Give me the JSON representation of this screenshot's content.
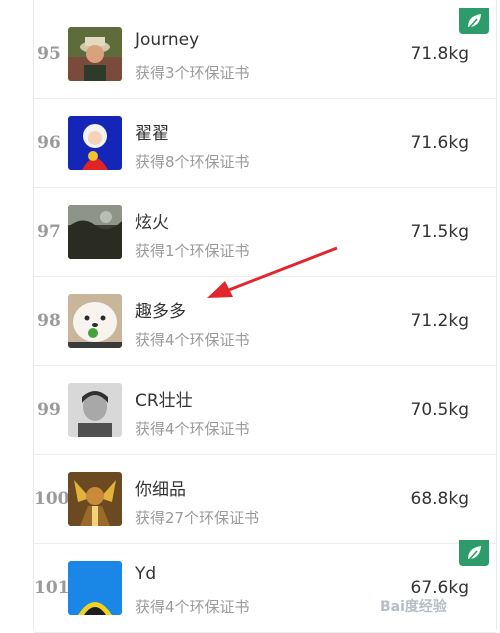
{
  "list": {
    "rows": [
      {
        "rank": "95",
        "name": "Journey",
        "certs": "获得3个环保证书",
        "weight": "71.8kg",
        "badge": true,
        "avatar": "avatar-man-outdoor-icon"
      },
      {
        "rank": "96",
        "name": "翟翟",
        "certs": "获得8个环保证书",
        "weight": "71.6kg",
        "badge": false,
        "avatar": "avatar-cartoon-girl-icon"
      },
      {
        "rank": "97",
        "name": "炫火",
        "certs": "获得1个环保证书",
        "weight": "71.5kg",
        "badge": false,
        "avatar": "avatar-dark-landscape-icon"
      },
      {
        "rank": "98",
        "name": "趣多多",
        "certs": "获得4个环保证书",
        "weight": "71.2kg",
        "badge": false,
        "avatar": "avatar-white-dog-icon"
      },
      {
        "rank": "99",
        "name": "CR壮壮",
        "certs": "获得4个环保证书",
        "weight": "70.5kg",
        "badge": false,
        "avatar": "avatar-bw-portrait-icon"
      },
      {
        "rank": "100",
        "name": "你细品",
        "certs": "获得27个环保证书",
        "weight": "68.8kg",
        "badge": false,
        "avatar": "avatar-warrior-game-icon"
      },
      {
        "rank": "101",
        "name": "Yd",
        "certs": "获得4个环保证书",
        "weight": "67.6kg",
        "badge": true,
        "avatar": "avatar-blue-cartoon-icon"
      }
    ]
  },
  "annotation": {
    "arrow_color": "#e3262d"
  },
  "theme": {
    "badge_color": "#2e9c6a"
  },
  "watermark": {
    "text": "Bai度经验"
  }
}
